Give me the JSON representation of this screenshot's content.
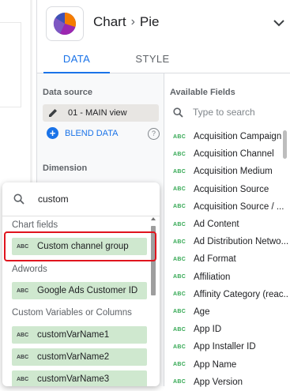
{
  "header": {
    "chart_label": "Chart",
    "chart_type": "Pie"
  },
  "tabs": [
    {
      "label": "DATA"
    },
    {
      "label": "STYLE"
    }
  ],
  "data_source": {
    "title": "Data source",
    "name": "01 - MAIN view",
    "blend_label": "BLEND DATA"
  },
  "dimension": {
    "title": "Dimension"
  },
  "available_fields": {
    "title": "Available Fields",
    "search_placeholder": "Type to search",
    "type_label": "ABC",
    "items": [
      "Acquisition Campaign",
      "Acquisition Channel",
      "Acquisition Medium",
      "Acquisition Source",
      "Acquisition Source / ...",
      "Ad Content",
      "Ad Distribution Netwo...",
      "Ad Format",
      "Affiliation",
      "Affinity Category (reac...",
      "Age",
      "App ID",
      "App Installer ID",
      "App Name",
      "App Version"
    ]
  },
  "dropdown": {
    "search_value": "custom",
    "type_label": "ABC",
    "groups": [
      {
        "label": "Chart fields",
        "items": [
          "Custom channel group"
        ]
      },
      {
        "label": "Adwords",
        "items": [
          "Google Ads Customer ID"
        ]
      },
      {
        "label": "Custom Variables or Columns",
        "items": [
          "customVarName1",
          "customVarName2",
          "customVarName3"
        ]
      }
    ]
  },
  "colors": {
    "accent": "#1a73e8",
    "field_chip": "#cfe8cf",
    "highlight_box": "#e0141e",
    "pie_orange": "#f57c00",
    "pie_purple": "#9c27b0",
    "pie_blue": "#3f51b5"
  },
  "icons": [
    "pie-chart-icon",
    "chevron-right-icon",
    "chevron-down-icon",
    "pencil-icon",
    "plus-icon",
    "help-icon",
    "search-icon"
  ]
}
